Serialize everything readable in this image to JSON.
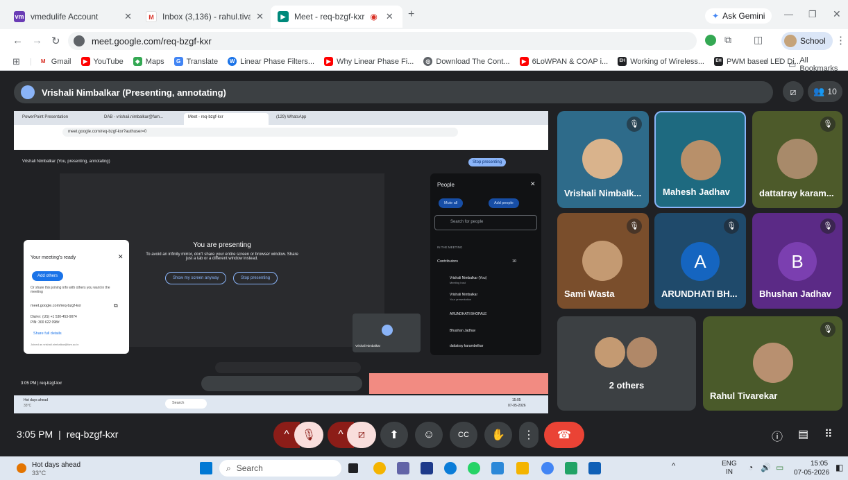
{
  "tabs": [
    {
      "label": "vmedulife Account",
      "icon": "vmedulife-icon",
      "color": "#6a3cb5"
    },
    {
      "label": "Inbox (3,136) - rahul.tivarekar@...",
      "icon": "gmail-icon",
      "color": "#d93025"
    },
    {
      "label": "Meet - req-bzgf-kxr",
      "icon": "meet-icon",
      "color": "#00897b"
    }
  ],
  "ask_gemini": "Ask Gemini",
  "url": "meet.google.com/req-bzgf-kxr",
  "profile": "School",
  "bookmarks": [
    {
      "label": "Gmail",
      "color": "#d93025",
      "ic": "M"
    },
    {
      "label": "YouTube",
      "color": "#ff0000",
      "ic": "▶"
    },
    {
      "label": "Maps",
      "color": "#34a853",
      "ic": "◆"
    },
    {
      "label": "Translate",
      "color": "#4285f4",
      "ic": "G"
    },
    {
      "label": "Linear Phase Filters...",
      "color": "#1a73e8",
      "ic": "W"
    },
    {
      "label": "Why Linear Phase Fi...",
      "color": "#ff0000",
      "ic": "▶"
    },
    {
      "label": "Download The Cont...",
      "color": "#5f6368",
      "ic": "◎"
    },
    {
      "label": "6LoWPAN & COAP i...",
      "color": "#ff0000",
      "ic": "▶"
    },
    {
      "label": "Working of Wireless...",
      "color": "#202124",
      "ic": "EH"
    },
    {
      "label": "PWM based LED Di...",
      "color": "#202124",
      "ic": "EH"
    }
  ],
  "more_bookmarks": "»",
  "all_bookmarks": "All Bookmarks",
  "presenter_banner": "Vrishali Nimbalkar (Presenting, annotating)",
  "participant_count": "10",
  "participants": [
    {
      "name": "Vrishali Nimbalk...",
      "bg": "#2e6b8a"
    },
    {
      "name": "Mahesh Jadhav",
      "bg": "#1e6a80"
    },
    {
      "name": "dattatray karam...",
      "bg": "#4d5a2a"
    },
    {
      "name": "Sami Wasta",
      "bg": "#7a4e2c"
    },
    {
      "name": "ARUNDHATI BH...",
      "bg": "#1f4a6b",
      "letter": "A",
      "letter_bg": "#1565c0"
    },
    {
      "name": "Bhushan Jadhav",
      "bg": "#5b2a86",
      "letter": "B",
      "letter_bg": "#7b3fb0"
    },
    {
      "name": "2 others",
      "bg": "#3c4043"
    },
    {
      "name": "Rahul Tivarekar",
      "bg": "#4a5a2a"
    }
  ],
  "shared": {
    "inner_tabs": [
      "PowerPoint Presentation",
      "DAB - vrishali.nimbalkar@fam...",
      "Meet - req-bzgf-kxr",
      "(129) WhatsApp"
    ],
    "inner_url": "meet.google.com/req-bzgf-kxr?authuser=0",
    "inner_banner": "Vrishali Nimbalkar (You, presenting, annotating)",
    "stop_presenting": "Stop presenting",
    "you_are_presenting": "You are presenting",
    "mirror_warning": "To avoid an infinity mirror, don't share your entire screen or browser window. Share just a tab or a different window instead.",
    "show_anyway": "Show my screen anyway",
    "stop_btn": "Stop presenting",
    "meeting_ready": "Your meeting's ready",
    "add_others": "Add others",
    "share_text": "Or share this joining info with others you want in the meeting",
    "meet_link": "meet.google.com/req-bzgf-kxr",
    "dial_in": "Dial-in: (US) +1 530-453-9074",
    "pin": "PIN: 300 622 098#",
    "share_full": "Share full details",
    "joined_as": "Joined as vrishali.nimbalkar@fam.ac.in",
    "people_title": "People",
    "mute_all": "Mute all",
    "add_people": "Add people",
    "search_people": "Search for people",
    "in_meeting": "IN THE MEETING",
    "contributors": "Contributors",
    "contributors_count": "10",
    "people_list": [
      {
        "name": "Vrishali Nimbalkar (You)",
        "sub": "Meeting host"
      },
      {
        "name": "Vrishali Nimbalkar",
        "sub": "Your presentation"
      },
      {
        "name": "ARUNDHATI BHOPALE",
        "sub": ""
      },
      {
        "name": "Bhushan Jadhav",
        "sub": ""
      },
      {
        "name": "dattatray karambelkar",
        "sub": ""
      }
    ],
    "self_tile": "Vrishali Nimbalkar",
    "inner_time": "3:05 PM | req-bzgf-kxr",
    "inner_weather": "Hot days ahead",
    "inner_temp": "33°C",
    "inner_search": "Search",
    "inner_clock_time": "15:05",
    "inner_clock_date": "07-05-2026"
  },
  "meeting_time": "3:05 PM",
  "meeting_code": "req-bzgf-kxr",
  "taskbar": {
    "weather": "Hot days ahead",
    "temp": "33°C",
    "search": "Search",
    "lang": "ENG",
    "region": "IN",
    "time": "15:05",
    "date": "07-05-2026"
  },
  "colors": {
    "end_call": "#ea4335",
    "muted_red": "#f9dedc",
    "dark_red": "#8c1d18"
  }
}
